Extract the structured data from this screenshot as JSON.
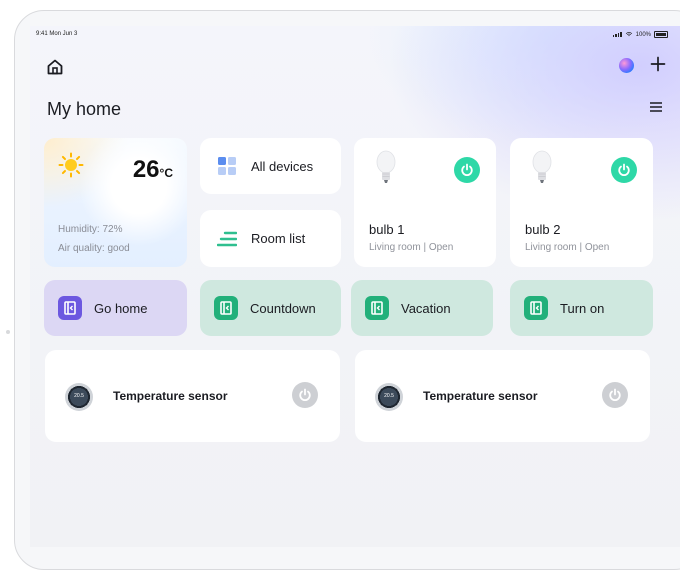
{
  "status_bar": {
    "time": "9:41  Mon Jun 3",
    "battery": "100%"
  },
  "header": {
    "title": "My home"
  },
  "weather": {
    "temperature": "26",
    "unit": "°C",
    "humidity": "Humidity: 72%",
    "air_quality": "Air quality: good"
  },
  "quick": {
    "all_devices": "All devices",
    "room_list": "Room list"
  },
  "devices": [
    {
      "name": "bulb 1",
      "room": "Living room",
      "state": "Open",
      "status": "Living room | Open"
    },
    {
      "name": "bulb 2",
      "room": "Living room",
      "state": "Open",
      "status": "Living room | Open"
    }
  ],
  "scenes": [
    {
      "label": "Go home",
      "icon_color": "#6c58e0",
      "bg": "#dcd7f4"
    },
    {
      "label": "Countdown",
      "icon_color": "#22b07a",
      "bg": "#cfe8df"
    },
    {
      "label": "Vacation",
      "icon_color": "#22b07a",
      "bg": "#cfe8df"
    },
    {
      "label": "Turn on",
      "icon_color": "#22b07a",
      "bg": "#cfe8df"
    }
  ],
  "sensors": [
    {
      "label": "Temperature sensor",
      "reading": "20.5"
    },
    {
      "label": "Temperature sensor",
      "reading": "20.5"
    }
  ],
  "colors": {
    "accent_green": "#2ed8a7",
    "power_off": "#cdcfd3"
  }
}
